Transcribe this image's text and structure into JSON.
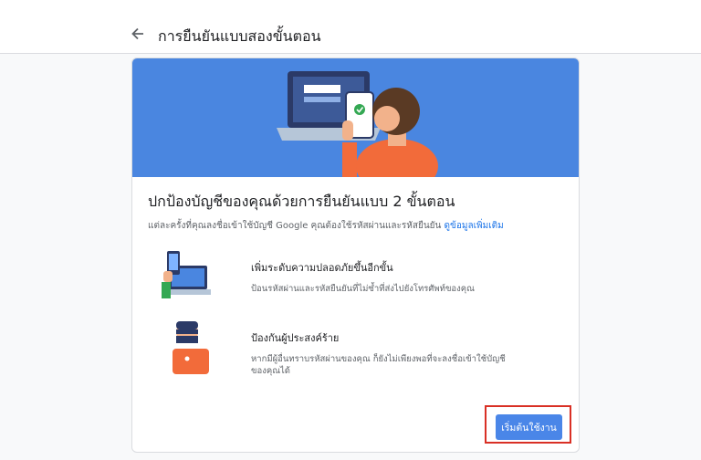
{
  "header": {
    "title": "การยืนยันแบบสองขั้นตอน",
    "back_icon": "arrow-left-icon"
  },
  "card": {
    "heading": "ปกป้องบัญชีของคุณด้วยการยืนยันแบบ 2 ขั้นตอน",
    "description": "แต่ละครั้งที่คุณลงชื่อเข้าใช้บัญชี Google คุณต้องใช้รหัสผ่านและรหัสยืนยัน",
    "learn_more": "ดูข้อมูลเพิ่มเติม",
    "features": [
      {
        "title": "เพิ่มระดับความปลอดภัยขึ้นอีกขั้น",
        "body": "ป้อนรหัสผ่านและรหัสยืนยันที่ไม่ซ้ำที่ส่งไปยังโทรศัพท์ของคุณ",
        "icon": "phone-laptop-icon"
      },
      {
        "title": "ป้องกันผู้ประสงค์ร้าย",
        "body": "หากมีผู้อื่นทราบรหัสผ่านของคุณ ก็ยังไม่เพียงพอที่จะลงชื่อเข้าใช้บัญชีของคุณได้",
        "icon": "hacker-icon"
      }
    ],
    "start_button": "เริ่มต้นใช้งาน"
  },
  "colors": {
    "hero_bg": "#4a86e0",
    "button": "#4a86e8",
    "link": "#1a73e8",
    "highlight": "#d93025"
  }
}
